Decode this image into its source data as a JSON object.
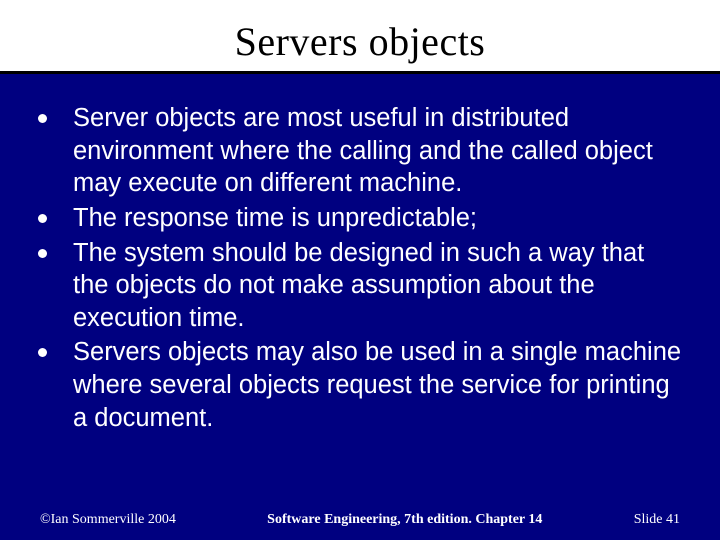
{
  "slide": {
    "title": "Servers objects",
    "bullets": [
      "Server objects are most useful in distributed environment where the calling and the called object may execute on different machine.",
      "The response time is unpredictable;",
      "The system should be designed in such a way that the objects do not make assumption about the execution time.",
      "Servers objects may also be used in a single machine where several objects request the service for printing a document."
    ],
    "footer": {
      "left": "©Ian Sommerville 2004",
      "center": "Software Engineering, 7th edition. Chapter 14",
      "right_prefix": "Slide ",
      "right_number": "41"
    }
  }
}
